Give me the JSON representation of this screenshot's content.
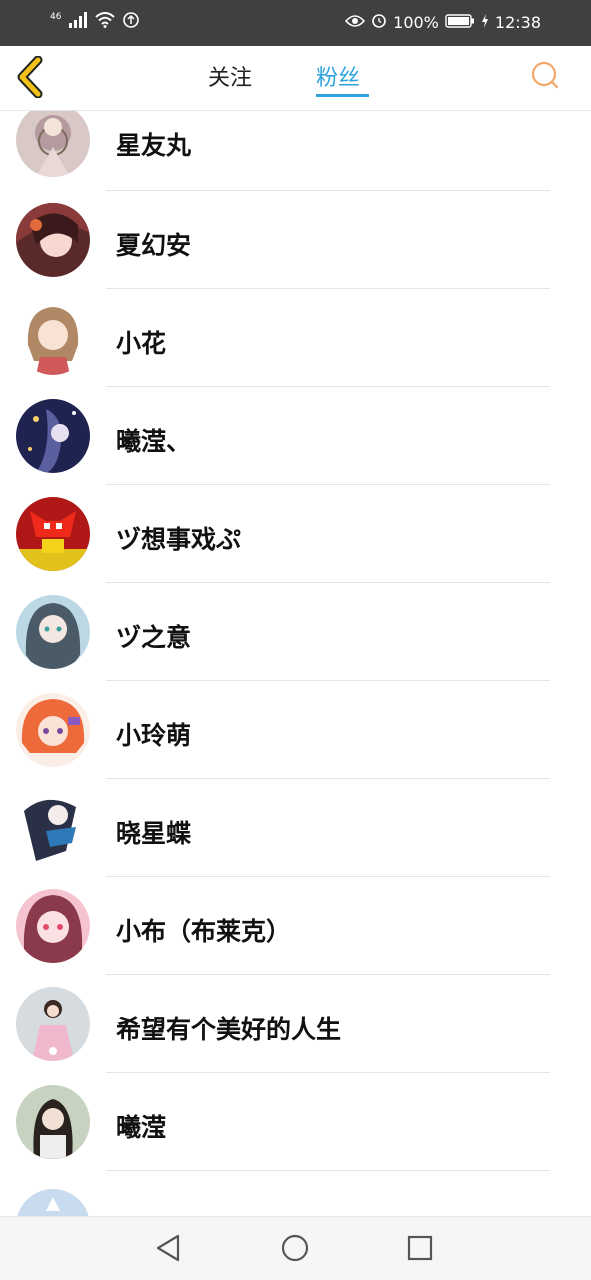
{
  "status_bar": {
    "network": "46",
    "battery": "100%",
    "time": "12:38",
    "icons": [
      "signal-icon",
      "wifi-icon",
      "data-saver-icon",
      "eye-icon",
      "alarm-icon",
      "battery-icon",
      "charging-icon"
    ]
  },
  "header": {
    "tabs": [
      {
        "label": "关注",
        "active": false
      },
      {
        "label": "粉丝",
        "active": true
      }
    ],
    "accent_color": "#2fa3de",
    "back_icon": "back-arrow-icon",
    "back_icon_color": "#f2c21a",
    "search_icon": "search-icon",
    "search_icon_color": "#f2a76a"
  },
  "followers": [
    {
      "name": "星友丸"
    },
    {
      "name": "夏幻安"
    },
    {
      "name": "小花"
    },
    {
      "name": "曦滢、"
    },
    {
      "name": "ヅ想事戏ぷ"
    },
    {
      "name": "ヅ之意"
    },
    {
      "name": "小玲萌"
    },
    {
      "name": "晓星蝶"
    },
    {
      "name": "小布（布莱克）"
    },
    {
      "name": "希望有个美好的人生"
    },
    {
      "name": "曦滢"
    }
  ],
  "nav_bar": {
    "icons": [
      "back-triangle-icon",
      "home-circle-icon",
      "recents-square-icon"
    ]
  }
}
